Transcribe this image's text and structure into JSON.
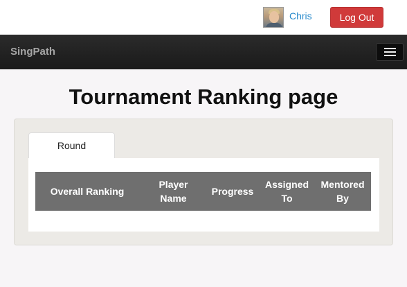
{
  "user": {
    "name": "Chris",
    "logout_label": "Log Out",
    "avatar_icon": "user-avatar"
  },
  "navbar": {
    "brand": "SingPath",
    "menu_icon": "hamburger-menu-icon"
  },
  "page": {
    "title": "Tournament Ranking page"
  },
  "tabs": [
    {
      "label": "Round"
    }
  ],
  "table": {
    "columns": [
      "Overall Ranking",
      "Player Name",
      "Progress",
      "Assigned To",
      "Mentored By"
    ],
    "rows": []
  },
  "colors": {
    "logout_button": "#d03a3a",
    "link": "#2a8bcc",
    "navbar": "#1e1e1e",
    "table_header": "#6f6f6f"
  }
}
